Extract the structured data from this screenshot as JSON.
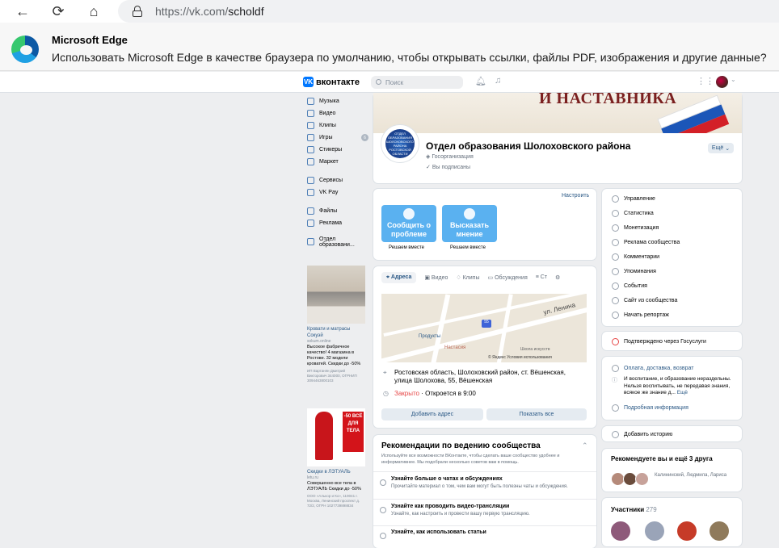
{
  "browser": {
    "url_host": "https://vk.com/",
    "url_path": "scholdf",
    "back_label": "←",
    "reload_label": "⟳",
    "home_label": "⌂"
  },
  "banner": {
    "title": "Microsoft Edge",
    "message": "Использовать Microsoft Edge в качестве браузера по умолчанию, чтобы открывать ссылки, файлы PDF, изображения и другие данные?"
  },
  "vk": {
    "logo": "вконтакте",
    "logo_glyph": "VK",
    "search_placeholder": "Поиск"
  },
  "left_menu": [
    "Музыка",
    "Видео",
    "Клипы",
    "Игры",
    "Стикеры",
    "Маркет",
    "Сервисы",
    "VK Pay",
    "Файлы",
    "Реклама",
    "Отдел образовани..."
  ],
  "games_badge": "6",
  "ads": [
    {
      "title": "Кровати и матрасы Сокуэй",
      "source": "sokum.online",
      "desc": "Высокое фабричное качество! 4 магазина в Ростове. 32 модели кроватей. Скидки до -50%",
      "footer": "ИП Вартанян Дмитрий Викторович 344000, ОГРНИП 3094463800103",
      "badge": ""
    },
    {
      "title": "Скидки в ЛЭТУАЛЬ",
      "source": "letu.ru",
      "desc": "Совершенно все тела в ЛЭТУАЛЬ Скидки до -50%",
      "footer": "ООО «Алькор и Ко», 119041 г. Москва, Ленинский проспект д. 72/2, ОГРН 1027739898834",
      "badge": "-50 ВСЁ ДЛЯ ТЕЛА"
    }
  ],
  "profile": {
    "cover_text": "И НАСТАВНИКА",
    "name": "Отдел образования Шолоховского района",
    "type": "Госорганизация",
    "subscribed": "Вы подписаны",
    "more_button": "Ещё",
    "avatar_text": "ОТДЕЛ ОБРАЗОВАНИЯ ШОЛОХОВСКОГО РАЙОНА РОСТОВСКОЙ ОБЛАСТИ"
  },
  "feedback": {
    "configure": "Настроить",
    "report_label": "Сообщить о проблеме",
    "opinion_label": "Высказать мнение",
    "caption": "Решаем вместе"
  },
  "address": {
    "tabs": [
      "Адреса",
      "Видео",
      "Клипы",
      "Обсуждения",
      "Ст"
    ],
    "street": "ул. Ленина",
    "map_labels": [
      "Продукты",
      "Настасия",
      "Школа искусств"
    ],
    "map_badge": "55",
    "yandex": "© Яндекс Условия использования",
    "text": "Ростовская область, Шолоховский район, ст. Вёшенская, улица Шолохова, 55, Вёшенская",
    "closed": "Закрыто",
    "opens": " · Откроется в 9:00",
    "add_btn": "Добавить адрес",
    "show_btn": "Показать все"
  },
  "recommend": {
    "title": "Рекомендации по ведению сообщества",
    "desc": "Используйте все возможности ВКонтакте, чтобы сделать ваше сообщество удобнее и информативнее. Мы подобрали несколько советов вам в помощь.",
    "items": [
      {
        "t": "Узнайте больше о чатах и обсуждениях",
        "d": "Прочитайте материал о том, чем вам могут быть полезны чаты и обсуждения."
      },
      {
        "t": "Узнайте как проводить видео-трансляции",
        "d": "Узнайте, как настроить и провести вашу первую трансляцию."
      },
      {
        "t": "Узнайте, как использовать статьи",
        "d": ""
      }
    ]
  },
  "manage_menu": [
    "Управление",
    "Статистика",
    "Монетизация",
    "Реклама сообщества",
    "Комментарии",
    "Упоминания",
    "События",
    "Сайт из сообщества",
    "Начать репортаж"
  ],
  "gosuslugi": "Подтверждено через Госуслуги",
  "info": {
    "delivery": "Оплата, доставка, возврат",
    "about": "И воспитание, и образование нераздельны. Нельзя воспитывать, не передавая знания, всякое же знание д...",
    "more": "Ещё",
    "detail": "Подробная информация"
  },
  "add_story": "Добавить историю",
  "friends": {
    "title": "Рекомендуете вы и ещё 3 друга",
    "names": "Калининский, Людмила, Лариса"
  },
  "members": {
    "title": "Участники",
    "count": "279"
  }
}
